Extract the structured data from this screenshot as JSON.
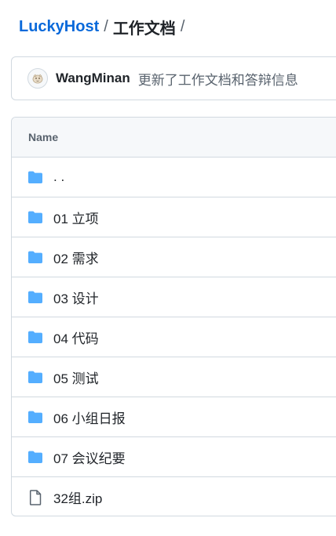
{
  "breadcrumb": {
    "repo": "LuckyHost",
    "separator": "/",
    "folder": "工作文档",
    "trailing_separator": "/"
  },
  "latest_commit": {
    "author": "WangMinan",
    "message": "更新了工作文档和答辩信息"
  },
  "files": {
    "header": "Name",
    "rows": [
      {
        "name": ". .",
        "type": "folder",
        "icon": "folder-icon"
      },
      {
        "name": "01 立项",
        "type": "folder",
        "icon": "folder-icon"
      },
      {
        "name": "02 需求",
        "type": "folder",
        "icon": "folder-icon"
      },
      {
        "name": "03 设计",
        "type": "folder",
        "icon": "folder-icon"
      },
      {
        "name": "04 代码",
        "type": "folder",
        "icon": "folder-icon"
      },
      {
        "name": "05 测试",
        "type": "folder",
        "icon": "folder-icon"
      },
      {
        "name": "06 小组日报",
        "type": "folder",
        "icon": "folder-icon"
      },
      {
        "name": "07 会议纪要",
        "type": "folder",
        "icon": "folder-icon"
      },
      {
        "name": "32组.zip",
        "type": "file",
        "icon": "file-icon"
      }
    ]
  },
  "colors": {
    "link": "#0969da",
    "folder": "#54aeff",
    "border": "#d1d9e0",
    "header_bg": "#f6f8fa",
    "muted_text": "#59636e"
  }
}
